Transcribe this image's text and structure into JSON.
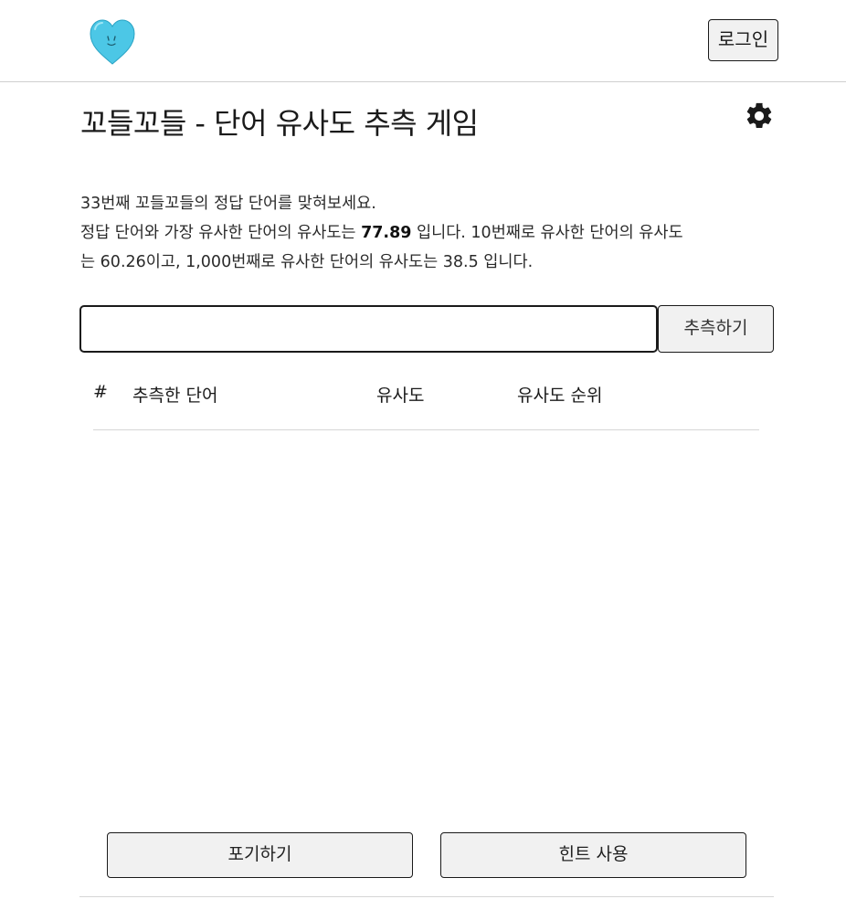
{
  "header": {
    "logo_icon": "heart-face-icon",
    "login_label": "로그인"
  },
  "title": "꼬들꼬들 - 단어 유사도 추측 게임",
  "settings_icon": "gear-icon",
  "intro": {
    "line1": "33번째 꼬들꼬들의 정답 단어를 맞혀보세요.",
    "line2_pre": "정답 단어와 가장 유사한 단어의 유사도는 ",
    "top_similarity": "77.89",
    "line2_mid": " 입니다. 10번째로 유사한 단어의 유사도",
    "line3_pre": "는 ",
    "tenth_similarity": "60.26",
    "line3_mid": "이고,  1,000번째로 유사한 단어의 유사도는 ",
    "thousandth_similarity": "38.5",
    "line3_post": " 입니다."
  },
  "guess": {
    "input_value": "",
    "button_label": "추측하기"
  },
  "table": {
    "columns": [
      "#",
      "추측한 단어",
      "유사도",
      "유사도 순위"
    ],
    "rows": []
  },
  "bottom": {
    "giveup_label": "포기하기",
    "hint_label": "힌트 사용"
  },
  "colors": {
    "logo_heart": "#4cc7e6",
    "text": "#1a1a1a",
    "button_bg": "#f1f1f1"
  }
}
